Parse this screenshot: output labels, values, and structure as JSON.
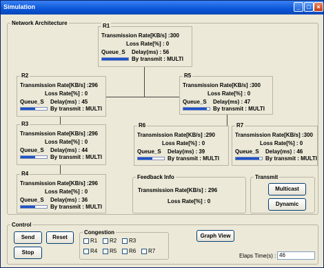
{
  "window": {
    "title": "Simulation"
  },
  "network": {
    "legend": "Network Architecture",
    "labels": {
      "rate": "Transmission Rate[KB/s] :",
      "loss": "Loss  Rate[%] :",
      "queue": "Queue_S",
      "delay": "Delay(ms) :",
      "transmit": "By transmit : "
    },
    "nodes": {
      "R1": {
        "name": "R1",
        "rate": "300",
        "loss": "0",
        "delay": "56",
        "transmit": "MULTI",
        "queue_fill": 1.0
      },
      "R2": {
        "name": "R2",
        "rate": "296",
        "loss": "0",
        "delay": "45",
        "transmit": "MULTI",
        "queue_fill": 0.55
      },
      "R3": {
        "name": "R3",
        "rate": "296",
        "loss": "0",
        "delay": "44",
        "transmit": "MULTI",
        "queue_fill": 0.55
      },
      "R4": {
        "name": "R4",
        "rate": "296",
        "loss": "0",
        "delay": "36",
        "transmit": "MULTI",
        "queue_fill": 0.55
      },
      "R5": {
        "name": "R5",
        "rate": "300",
        "loss": "0",
        "delay": "47",
        "transmit": "MULTI",
        "queue_fill": 0.9
      },
      "R6": {
        "name": "R6",
        "rate": "290",
        "loss": "0",
        "delay": "39",
        "transmit": "MULTI",
        "queue_fill": 0.55
      },
      "R7": {
        "name": "R7",
        "rate": "300",
        "loss": "0",
        "delay": "46",
        "transmit": "MULTI",
        "queue_fill": 0.9
      }
    }
  },
  "feedback": {
    "legend": "Feedback Info",
    "rate_label": "Transmission Rate[KB/s] :",
    "rate": "296",
    "loss_label": "Loss Rate[%] :",
    "loss": "0"
  },
  "transmit": {
    "legend": "Transmit",
    "multicast": "Multicast",
    "dynamic": "Dynamic"
  },
  "control": {
    "legend": "Control",
    "send": "Send",
    "reset": "Reset",
    "stop": "Stop",
    "graph_view": "Graph View",
    "congestion": {
      "legend": "Congestion",
      "row1": [
        "R1",
        "R2",
        "R3"
      ],
      "row2": [
        "R4",
        "R5",
        "R6",
        "R7"
      ]
    },
    "elaps_label": "Elaps Time(s) :",
    "elaps_value": "46"
  }
}
